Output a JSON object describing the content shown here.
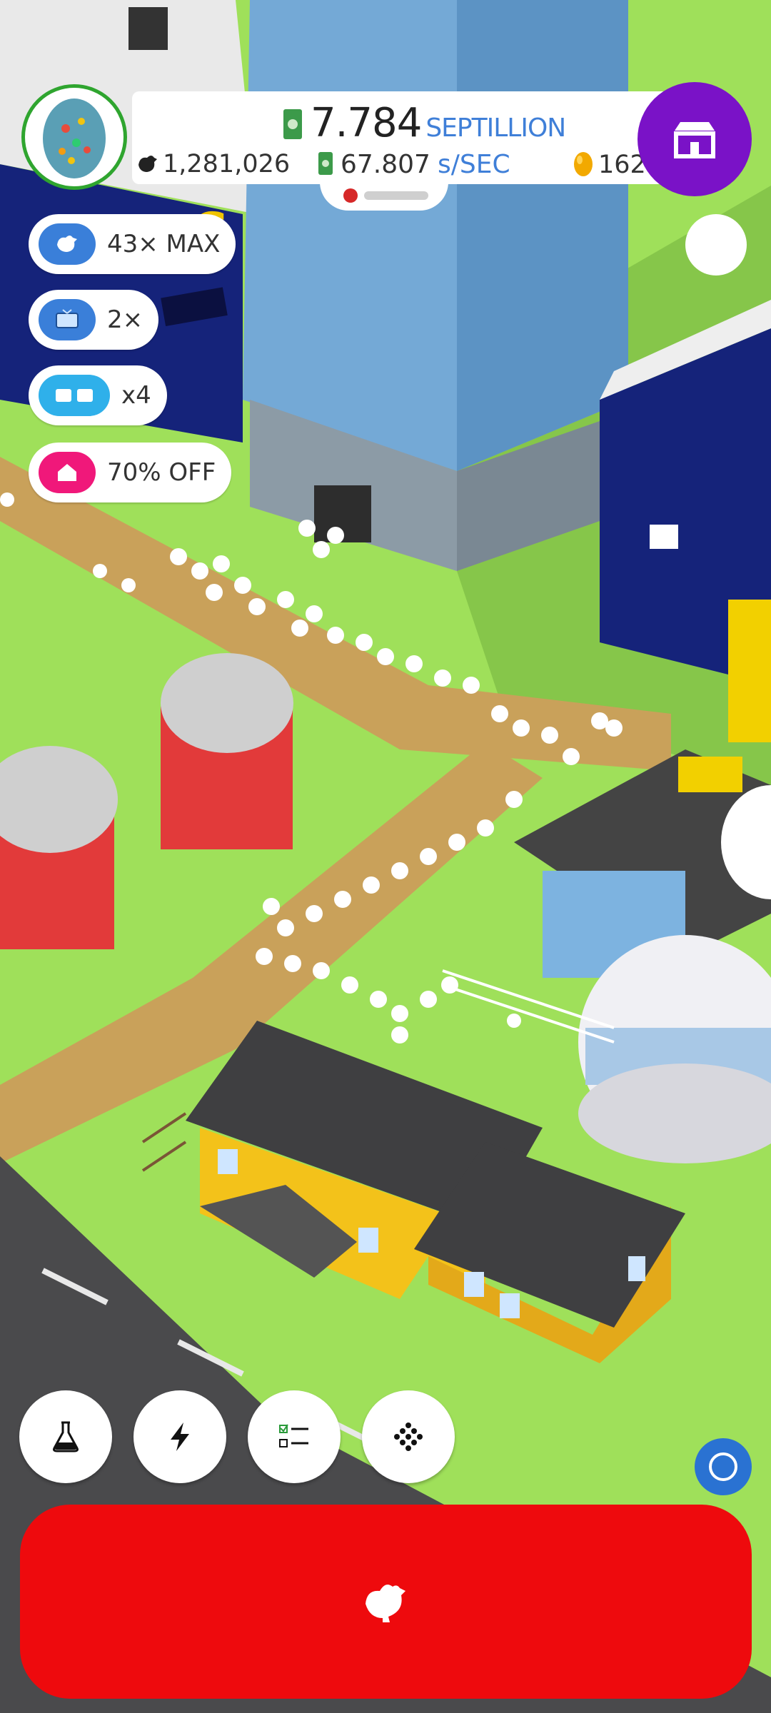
{
  "hud": {
    "money_value": "7.784",
    "money_unit": "SEPTILLION",
    "chicken_count": "1,281,026",
    "earning_rate": "67.807",
    "earning_rate_unit": "s/SEC",
    "golden_eggs": "162"
  },
  "boosts": [
    {
      "label": "43× MAX",
      "icon": "chicken-icon",
      "color": "#3a7fd9"
    },
    {
      "label": "2×",
      "icon": "tv-icon",
      "color": "#3a7fd9"
    },
    {
      "label": "x4",
      "icon": "boost-icon",
      "color": "#2fb0ea"
    },
    {
      "label": "70% OFF",
      "icon": "house-icon",
      "color": "#f0187a"
    }
  ],
  "toolbar": [
    "flask-icon",
    "lightning-icon",
    "checklist-icon",
    "grid-dots-icon"
  ],
  "colors": {
    "grass": "#9fe05a",
    "road": "#4a4a4c",
    "path": "#c9a15a",
    "hatch_button": "#ee0a0d",
    "shop_button": "#7a12c7"
  }
}
